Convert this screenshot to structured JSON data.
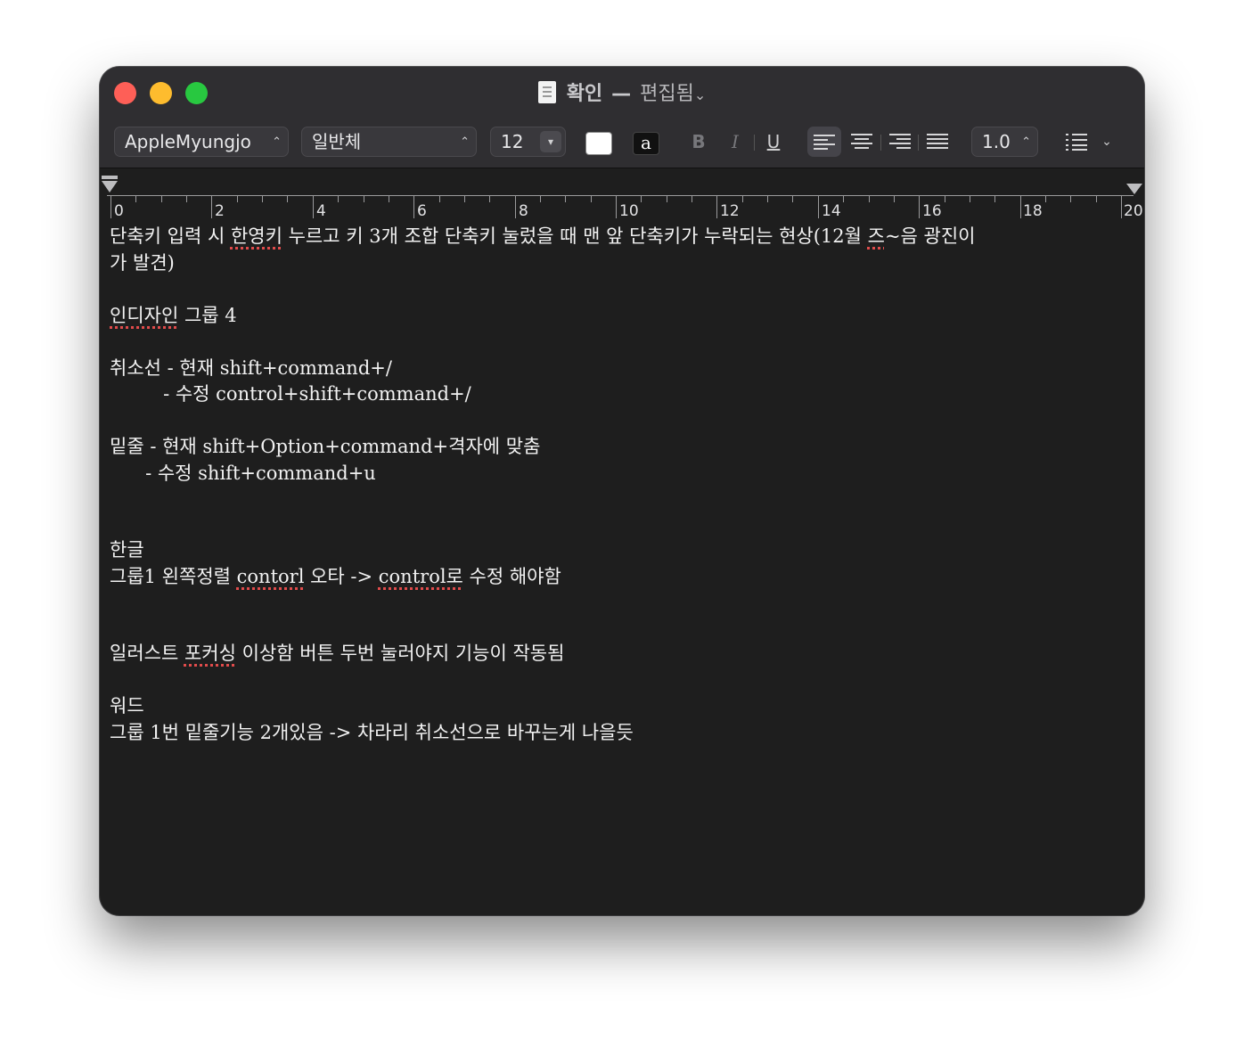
{
  "window": {
    "title": "확인",
    "separator": "—",
    "status": "편집됨",
    "title_chevron": "⌄"
  },
  "toolbar": {
    "font_family": "AppleMyungjo",
    "font_style": "일반체",
    "font_size": "12",
    "bold_label": "B",
    "italic_label": "I",
    "underline_label": "U",
    "line_spacing": "1.0",
    "text_color": "#ffffff",
    "highlight_glyph": "a"
  },
  "ruler": {
    "labels": [
      "0",
      "2",
      "4",
      "6",
      "8",
      "10",
      "12",
      "14",
      "16",
      "18",
      "20"
    ]
  },
  "document": {
    "l1a": "단축키 입력 시 ",
    "l1b": "한영키",
    "l1c": " 누르고 키 3개 조합 단축키 눌렀을 때 맨 앞 단축키가 누락되는 현상(12월 ",
    "l1d": "즈",
    "l1e": "~음 광진이",
    "l2": "가 발견)",
    "l3": "인디자인",
    "l3b": " 그룹 4",
    "l4": "취소선 - 현재 shift+command+/",
    "l5": "         - 수정 control+shift+command+/",
    "l6": "밑줄 - 현재 shift+Option+command+격자에 맞춤",
    "l7": "      - 수정 shift+command+u",
    "l8": "한글",
    "l9a": "그룹1 왼쪽정렬 ",
    "l9b": "contorl",
    "l9c": " 오타 -> ",
    "l9d": "control로",
    "l9e": " 수정 해야함",
    "l10a": "일러스트 ",
    "l10b": "포커싱",
    "l10c": " 이상함 버튼 두번 눌러야지 기능이 작동됨",
    "l11": "워드",
    "l12": "그룹 1번 밑줄기능 2개있음 -> 차라리 취소선으로 바꾸는게 나을듯"
  }
}
